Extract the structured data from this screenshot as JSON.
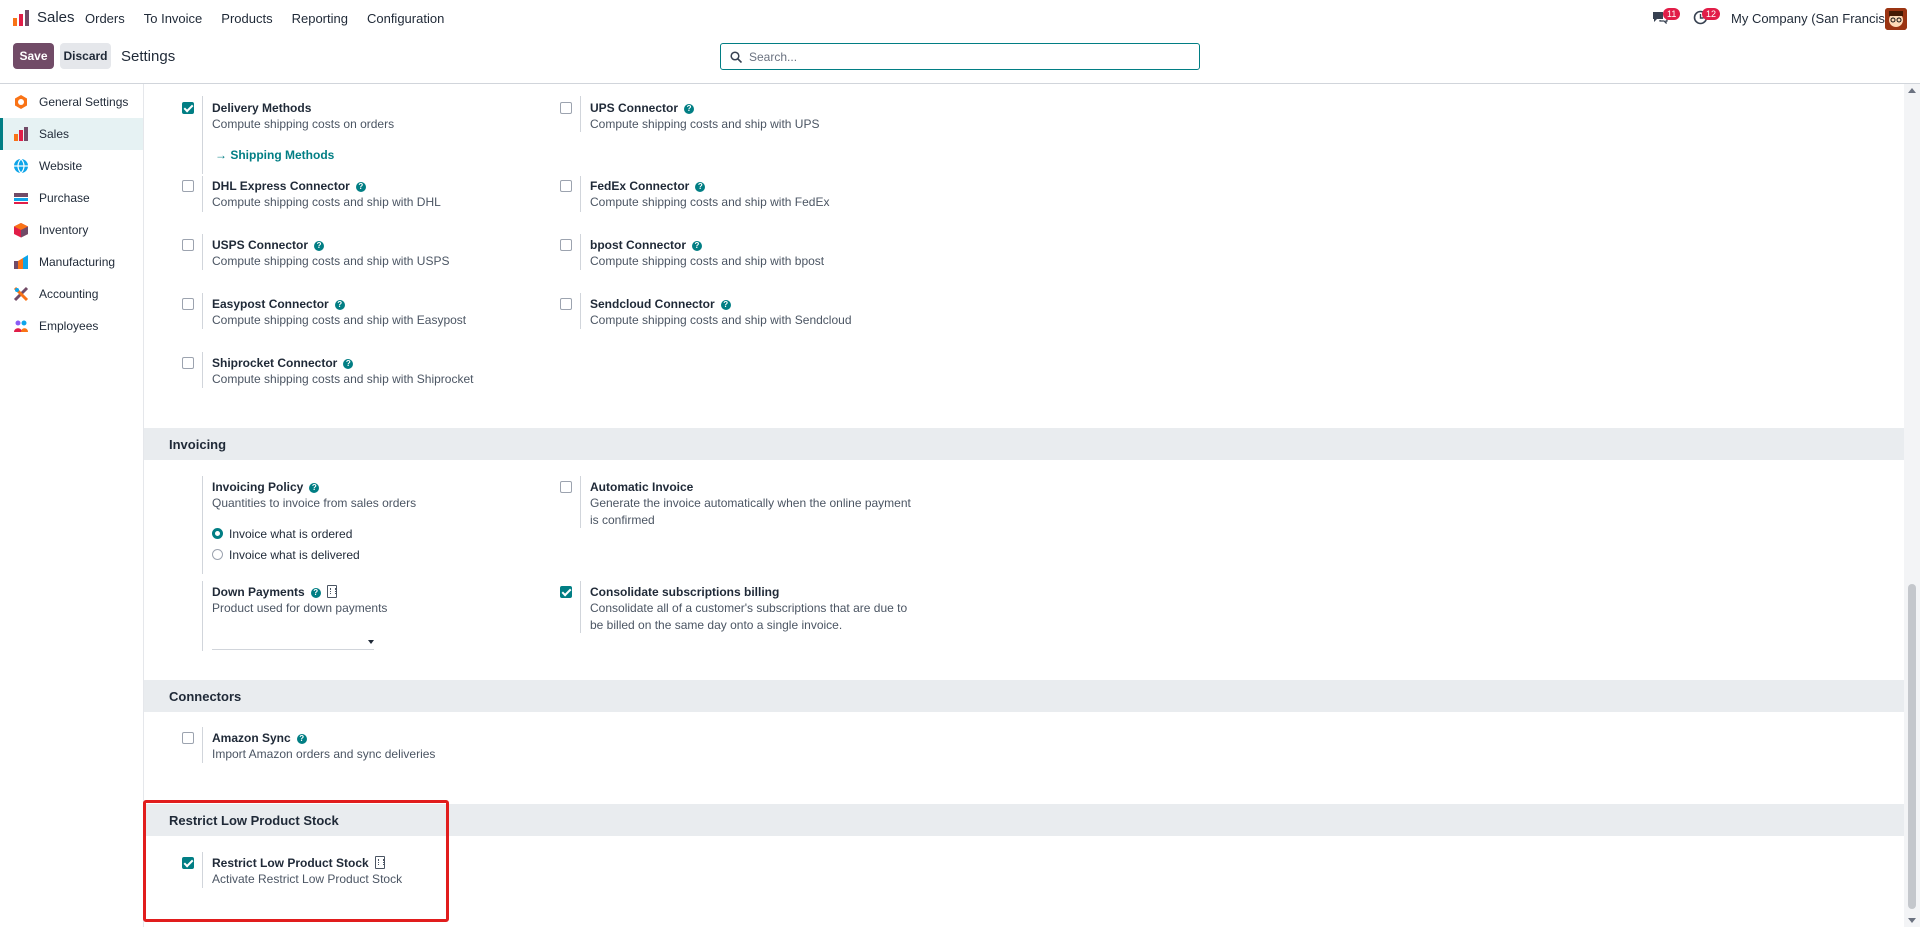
{
  "navbar": {
    "app_name": "Sales",
    "menu": [
      "Orders",
      "To Invoice",
      "Products",
      "Reporting",
      "Configuration"
    ],
    "chat_badge": "11",
    "activity_badge": "12",
    "company": "My Company (San Francisco)"
  },
  "control": {
    "save_label": "Save",
    "discard_label": "Discard",
    "title": "Settings",
    "search_placeholder": "Search..."
  },
  "sidebar": {
    "items": [
      {
        "label": "General Settings",
        "icon": "general-settings-icon",
        "color": "#f97316"
      },
      {
        "label": "Sales",
        "icon": "sales-icon",
        "color": "#e11d48",
        "active": true
      },
      {
        "label": "Website",
        "icon": "website-icon",
        "color": "#0ea5e9"
      },
      {
        "label": "Purchase",
        "icon": "purchase-icon",
        "color": "#714b67"
      },
      {
        "label": "Inventory",
        "icon": "inventory-icon",
        "color": "#e11d48"
      },
      {
        "label": "Manufacturing",
        "icon": "manufacturing-icon",
        "color": "#f97316"
      },
      {
        "label": "Accounting",
        "icon": "accounting-icon",
        "color": "#f97316"
      },
      {
        "label": "Employees",
        "icon": "employees-icon",
        "color": "#8b5cf6"
      }
    ]
  },
  "shipping": {
    "delivery_methods": {
      "title": "Delivery Methods",
      "desc": "Compute shipping costs on orders",
      "checked": true,
      "link": "Shipping Methods"
    },
    "ups": {
      "title": "UPS Connector",
      "desc": "Compute shipping costs and ship with UPS",
      "checked": false
    },
    "dhl": {
      "title": "DHL Express Connector",
      "desc": "Compute shipping costs and ship with DHL",
      "checked": false
    },
    "fedex": {
      "title": "FedEx Connector",
      "desc": "Compute shipping costs and ship with FedEx",
      "checked": false
    },
    "usps": {
      "title": "USPS Connector",
      "desc": "Compute shipping costs and ship with USPS",
      "checked": false
    },
    "bpost": {
      "title": "bpost Connector",
      "desc": "Compute shipping costs and ship with bpost",
      "checked": false
    },
    "easypost": {
      "title": "Easypost Connector",
      "desc": "Compute shipping costs and ship with Easypost",
      "checked": false
    },
    "sendcloud": {
      "title": "Sendcloud Connector",
      "desc": "Compute shipping costs and ship with Sendcloud",
      "checked": false
    },
    "shiprocket": {
      "title": "Shiprocket Connector",
      "desc": "Compute shipping costs and ship with Shiprocket",
      "checked": false
    }
  },
  "invoicing": {
    "section_title": "Invoicing",
    "policy": {
      "title": "Invoicing Policy",
      "desc": "Quantities to invoice from sales orders",
      "options": [
        "Invoice what is ordered",
        "Invoice what is delivered"
      ],
      "selected": 0
    },
    "automatic": {
      "title": "Automatic Invoice",
      "desc": "Generate the invoice automatically when the online payment is confirmed",
      "checked": false
    },
    "down_payments": {
      "title": "Down Payments",
      "desc": "Product used for down payments",
      "value": ""
    },
    "consolidate": {
      "title": "Consolidate subscriptions billing",
      "desc": "Consolidate all of a customer's subscriptions that are due to be billed on the same day onto a single invoice.",
      "checked": true
    }
  },
  "connectors": {
    "section_title": "Connectors",
    "amazon": {
      "title": "Amazon Sync",
      "desc": "Import Amazon orders and sync deliveries",
      "checked": false
    }
  },
  "restrict": {
    "section_title": "Restrict Low Product Stock",
    "setting": {
      "title": "Restrict Low Product Stock",
      "desc": "Activate Restrict Low Product Stock",
      "checked": true
    }
  },
  "colors": {
    "accent": "#017e84",
    "brand": "#714b67",
    "highlight": "#e11d1d",
    "badge": "#e11d48"
  }
}
